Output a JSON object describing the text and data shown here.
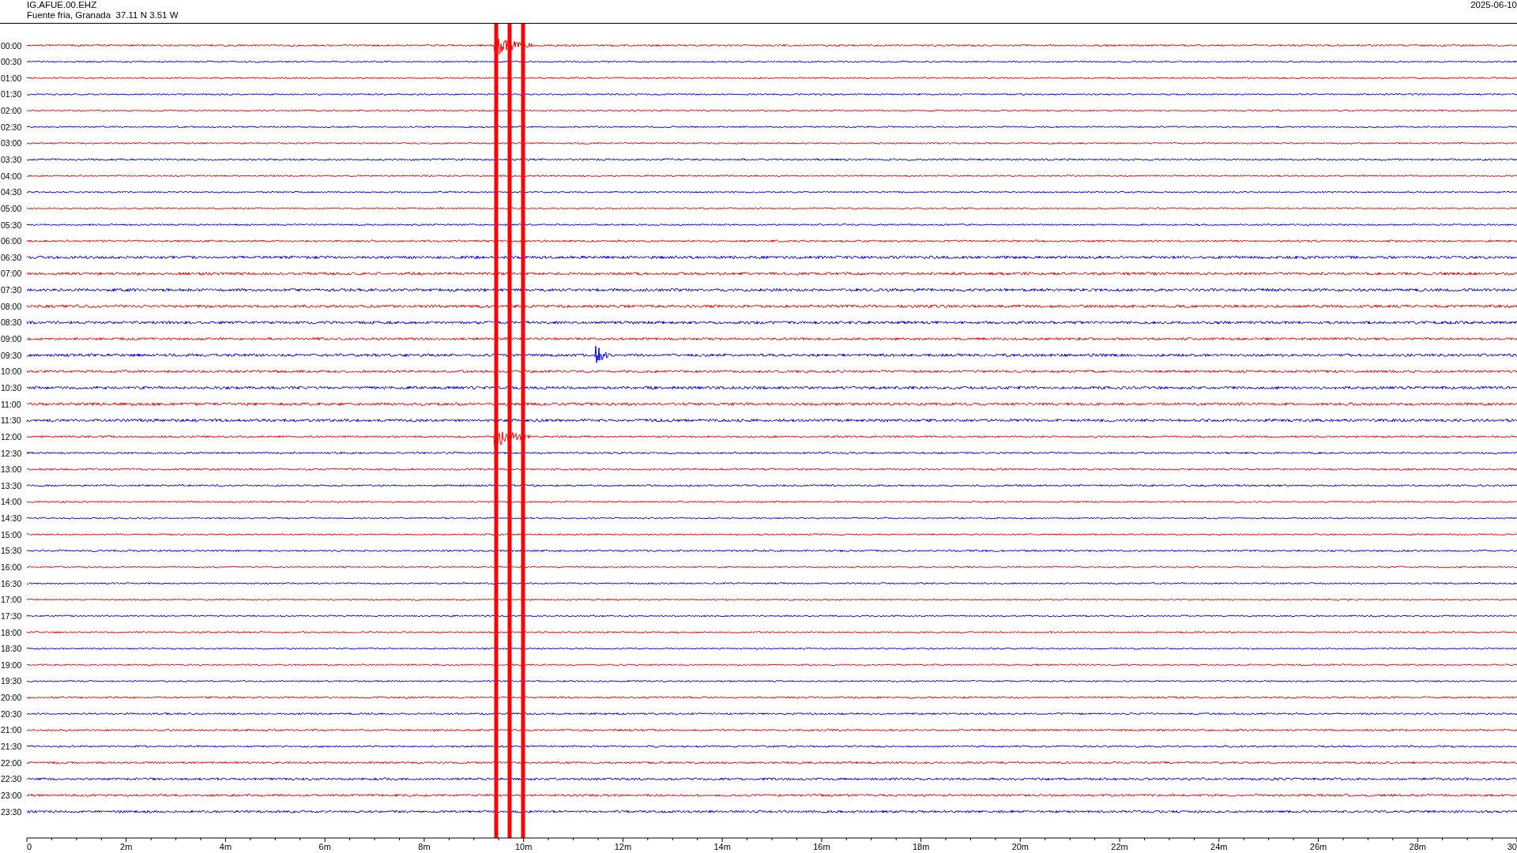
{
  "header": {
    "station": "IG.AFUE.00.EHZ",
    "location": "Fuente fria, Granada  37.11 N 3.51 W",
    "date": "2025-06-10"
  },
  "rows": [
    {
      "time": "00:00",
      "color": "#ff0000"
    },
    {
      "time": "00:30",
      "color": "#0000ff"
    },
    {
      "time": "01:00",
      "color": "#ff0000"
    },
    {
      "time": "01:30",
      "color": "#0000ff"
    },
    {
      "time": "02:00",
      "color": "#ff0000"
    },
    {
      "time": "02:30",
      "color": "#0000ff"
    },
    {
      "time": "03:00",
      "color": "#ff0000"
    },
    {
      "time": "03:30",
      "color": "#0000ff"
    },
    {
      "time": "04:00",
      "color": "#ff0000"
    },
    {
      "time": "04:30",
      "color": "#0000ff"
    },
    {
      "time": "05:00",
      "color": "#ff0000"
    },
    {
      "time": "05:30",
      "color": "#0000ff"
    },
    {
      "time": "06:00",
      "color": "#ff0000"
    },
    {
      "time": "06:30",
      "color": "#0000ff"
    },
    {
      "time": "07:00",
      "color": "#ff0000"
    },
    {
      "time": "07:30",
      "color": "#0000ff"
    },
    {
      "time": "08:00",
      "color": "#ff0000"
    },
    {
      "time": "08:30",
      "color": "#0000ff"
    },
    {
      "time": "09:00",
      "color": "#ff0000"
    },
    {
      "time": "09:30",
      "color": "#0000ff"
    },
    {
      "time": "10:00",
      "color": "#ff0000"
    },
    {
      "time": "10:30",
      "color": "#0000ff"
    },
    {
      "time": "11:00",
      "color": "#ff0000"
    },
    {
      "time": "11:30",
      "color": "#0000ff"
    },
    {
      "time": "12:00",
      "color": "#ff0000"
    },
    {
      "time": "12:30",
      "color": "#0000ff"
    },
    {
      "time": "13:00",
      "color": "#ff0000"
    },
    {
      "time": "13:30",
      "color": "#0000ff"
    },
    {
      "time": "14:00",
      "color": "#ff0000"
    },
    {
      "time": "14:30",
      "color": "#0000ff"
    },
    {
      "time": "15:00",
      "color": "#ff0000"
    },
    {
      "time": "15:30",
      "color": "#0000ff"
    },
    {
      "time": "16:00",
      "color": "#ff0000"
    },
    {
      "time": "16:30",
      "color": "#0000ff"
    },
    {
      "time": "17:00",
      "color": "#ff0000"
    },
    {
      "time": "17:30",
      "color": "#0000ff"
    },
    {
      "time": "18:00",
      "color": "#ff0000"
    },
    {
      "time": "18:30",
      "color": "#0000ff"
    },
    {
      "time": "19:00",
      "color": "#ff0000"
    },
    {
      "time": "19:30",
      "color": "#0000ff"
    },
    {
      "time": "20:00",
      "color": "#ff0000"
    },
    {
      "time": "20:30",
      "color": "#0000ff"
    },
    {
      "time": "21:00",
      "color": "#ff0000"
    },
    {
      "time": "21:30",
      "color": "#0000ff"
    },
    {
      "time": "22:00",
      "color": "#ff0000"
    },
    {
      "time": "22:30",
      "color": "#0000ff"
    },
    {
      "time": "23:00",
      "color": "#ff0000"
    },
    {
      "time": "23:30",
      "color": "#0000ff"
    }
  ],
  "axis_labels": [
    "0",
    "2m",
    "4m",
    "6m",
    "8m",
    "10m",
    "12m",
    "14m",
    "16m",
    "18m",
    "20m",
    "22m",
    "24m",
    "26m",
    "28m",
    "30"
  ]
}
